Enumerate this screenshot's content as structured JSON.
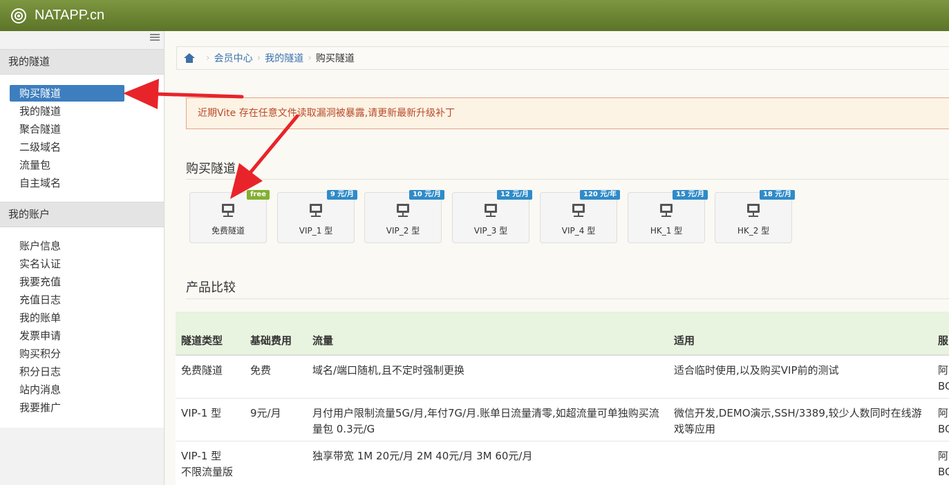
{
  "header": {
    "brand": "NATAPP.cn"
  },
  "sidebar": {
    "groups": [
      {
        "title": "我的隧道",
        "items": [
          "购买隧道",
          "我的隧道",
          "聚合隧道",
          "二级域名",
          "流量包",
          "自主域名"
        ]
      },
      {
        "title": "我的账户",
        "items": [
          "账户信息",
          "实名认证",
          "我要充值",
          "充值日志",
          "我的账单",
          "发票申请",
          "购买积分",
          "积分日志",
          "站内消息",
          "我要推广"
        ]
      }
    ],
    "active_item": "购买隧道"
  },
  "breadcrumb": {
    "items": [
      "会员中心",
      "我的隧道"
    ],
    "current": "购买隧道"
  },
  "alert": {
    "text": "近期Vite 存在任意文件读取漏洞被暴露,请更新最新升级补丁"
  },
  "buy_section": {
    "title": "购买隧道",
    "cards": [
      {
        "label": "免费隧道",
        "badge": "free"
      },
      {
        "label": "VIP_1 型",
        "badge": "9 元/月"
      },
      {
        "label": "VIP_2 型",
        "badge": "10 元/月"
      },
      {
        "label": "VIP_3 型",
        "badge": "12 元/月"
      },
      {
        "label": "VIP_4 型",
        "badge": "120 元/年"
      },
      {
        "label": "HK_1 型",
        "badge": "15 元/月"
      },
      {
        "label": "HK_2 型",
        "badge": "18 元/月"
      }
    ]
  },
  "compare_section": {
    "title": "产品比较",
    "headers": [
      "隧道类型",
      "基础费用",
      "流量",
      "适用",
      "服"
    ],
    "rows": [
      [
        "免费隧道",
        "免费",
        "域名/端口随机,且不定时强制更换",
        "适合临时使用,以及购买VIP前的测试",
        "阿\nBG"
      ],
      [
        "VIP-1 型",
        "9元/月",
        "月付用户限制流量5G/月,年付7G/月.账单日流量清零,如超流量可单独购买流量包 0.3元/G",
        "微信开发,DEMO演示,SSH/3389,较少人数同时在线游戏等应用",
        "阿\nBG"
      ],
      [
        "VIP-1 型\n不限流量版",
        "",
        "独享带宽 1M 20元/月 2M 40元/月 3M 60元/月",
        "",
        "阿\nBG"
      ]
    ]
  },
  "colors": {
    "header_green": "#6b8534",
    "active_blue": "#3d7ebf",
    "badge_blue": "#2f8bc8",
    "badge_green": "#82b030",
    "alert_red": "#b94a2a",
    "arrow_red": "#e8242a"
  }
}
